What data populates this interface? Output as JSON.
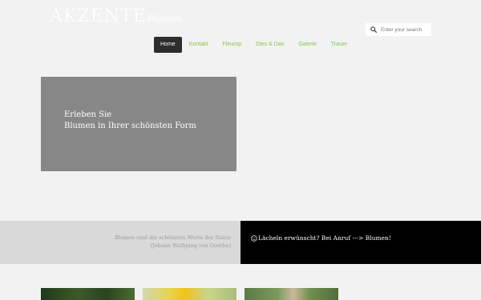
{
  "header": {
    "logo_main": "AKZENTE",
    "logo_sub": "Blumen"
  },
  "search": {
    "placeholder": "Enter your search",
    "icon": "search-icon"
  },
  "nav": {
    "items": [
      {
        "label": "Home",
        "active": true
      },
      {
        "label": "Kontakt",
        "active": false
      },
      {
        "label": "Fleurop",
        "active": false
      },
      {
        "label": "Dies & Das",
        "active": false
      },
      {
        "label": "Galerie",
        "active": false
      },
      {
        "label": "Trauer",
        "active": false
      }
    ],
    "accent_color": "#8bc34a",
    "active_bg": "#2d2d2d"
  },
  "hero": {
    "line1": "Erleben Sie",
    "line2": "Blumen in Ihrer schönsten Form"
  },
  "band": {
    "quote_line1": "Blumen sind die schönsten Worte der Natur",
    "quote_line2": "(Johann Wolfgang von Goethe)",
    "cta": "Lächeln erwünscht? Bei Anruf ---> Blumen!",
    "cta_icon": "smile-icon"
  },
  "gallery": {
    "thumbs": [
      "dark-foliage-photo",
      "yellow-flower-photo",
      "garden-plant-photo"
    ]
  }
}
